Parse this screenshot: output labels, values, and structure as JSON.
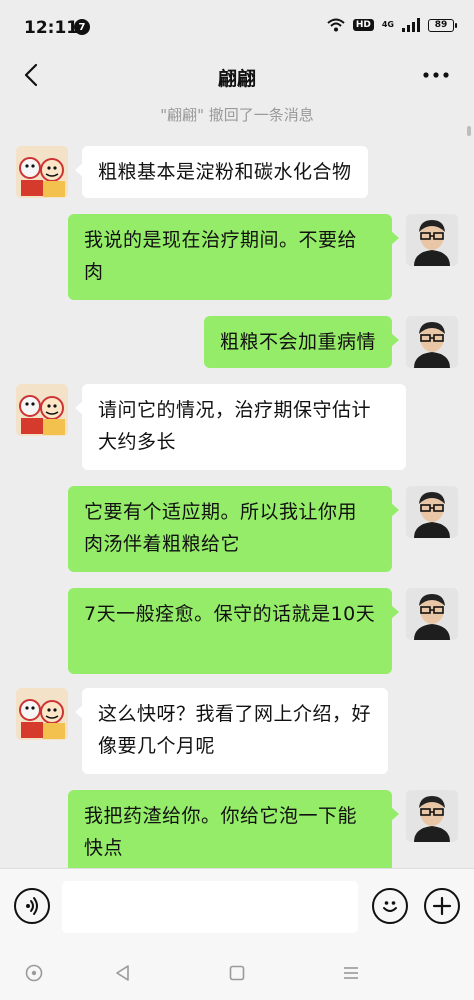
{
  "status_bar": {
    "time": "12:11",
    "notification_count": "7",
    "hd_label": "HD",
    "network_label": "4G",
    "battery": "89"
  },
  "header": {
    "title": "翩翩"
  },
  "system_notice": "\"翩翩\" 撤回了一条消息",
  "messages": [
    {
      "side": "left",
      "avatar": "cartoon-avatar",
      "text": "粗粮基本是淀粉和碳水化合物"
    },
    {
      "side": "right",
      "avatar": "man-glasses-avatar",
      "text": "我说的是现在治疗期间。不要给肉"
    },
    {
      "side": "right",
      "avatar": "man-glasses-avatar",
      "text": "粗粮不会加重病情"
    },
    {
      "side": "left",
      "avatar": "cartoon-avatar",
      "text": "请问它的情况，治疗期保守估计大约多长"
    },
    {
      "side": "right",
      "avatar": "man-glasses-avatar",
      "text": "它要有个适应期。所以我让你用肉汤伴着粗粮给它"
    },
    {
      "side": "right",
      "avatar": "man-glasses-avatar",
      "text": "7天一般痊愈。保守的话就是10天"
    },
    {
      "side": "left",
      "avatar": "cartoon-avatar",
      "text": "这么快呀？我看了网上介绍，好像要几个月呢"
    },
    {
      "side": "right",
      "avatar": "man-glasses-avatar",
      "text": "我把药渣给你。你给它泡一下能快点"
    }
  ],
  "input_bar": {
    "placeholder": "",
    "voice_icon": "voice-icon",
    "emoji_icon": "emoji-icon",
    "plus_icon": "plus-icon"
  },
  "colors": {
    "background": "#ededed",
    "outgoing_bubble": "#95ec69",
    "incoming_bubble": "#ffffff"
  }
}
